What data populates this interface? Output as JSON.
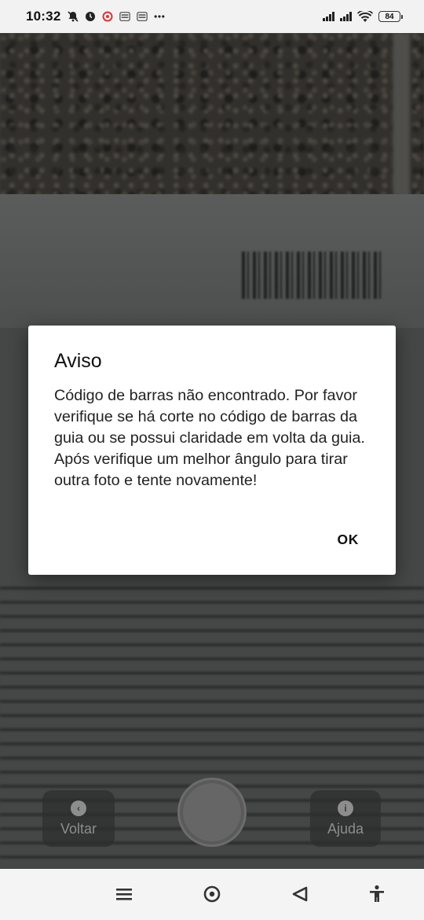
{
  "status_bar": {
    "time": "10:32",
    "battery": "84",
    "icons": [
      "mute-icon",
      "alarm-icon",
      "record-icon",
      "app-notification-icon",
      "app-notification-icon",
      "more-notifications-icon"
    ]
  },
  "dialog": {
    "title": "Aviso",
    "message": "Código de barras não encontrado. Por favor verifique se há corte no código de barras da guia ou se possui claridade em volta da guia. Após verifique um melhor ângulo para tirar outra foto e tente novamente!",
    "ok_label": "OK"
  },
  "camera_controls": {
    "back_label": "Voltar",
    "help_label": "Ajuda"
  },
  "nav_bar": {
    "buttons": [
      "menu-icon",
      "home-icon",
      "back-icon",
      "accessibility-icon"
    ]
  }
}
